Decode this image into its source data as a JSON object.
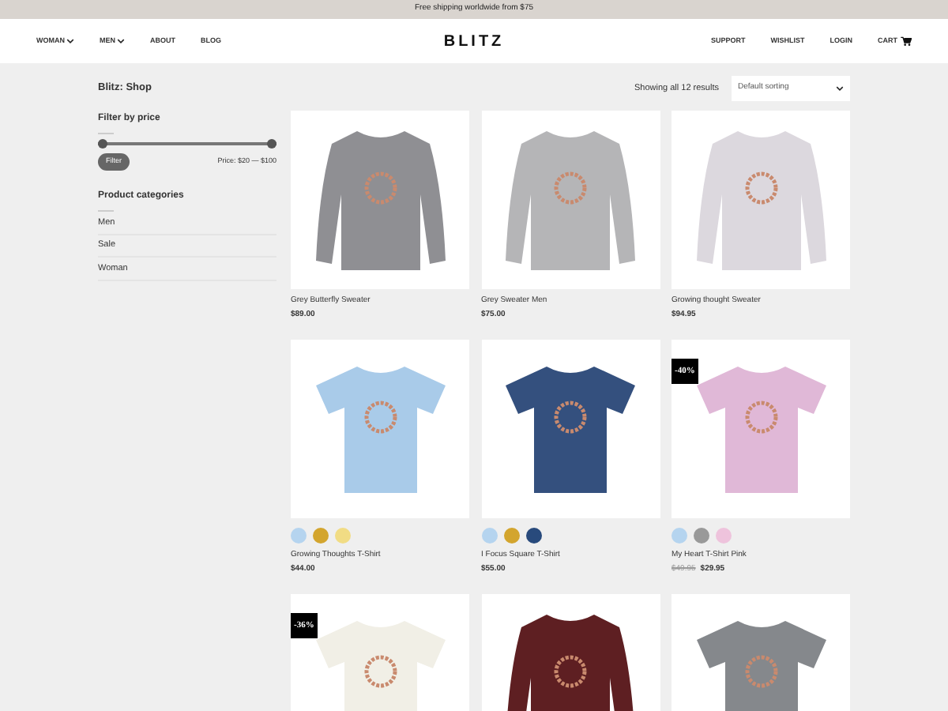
{
  "promo_bar": {
    "text": "Free shipping worldwide from $75"
  },
  "nav": {
    "left": [
      {
        "label": "WOMAN",
        "dropdown": true
      },
      {
        "label": "MEN",
        "dropdown": true
      },
      {
        "label": "ABOUT",
        "dropdown": false
      },
      {
        "label": "BLOG",
        "dropdown": false
      }
    ],
    "logo": "BLITZ",
    "right": [
      {
        "label": "SUPPORT",
        "kind": "link"
      },
      {
        "label": "WISHLIST",
        "kind": "link"
      },
      {
        "label": "LOGIN",
        "kind": "link"
      },
      {
        "label": "CART",
        "kind": "cart"
      }
    ]
  },
  "breadcrumb": "Blitz: Shop",
  "results": "Showing all 12 results",
  "sorting": {
    "value": "Default sorting"
  },
  "price_filter": {
    "title": "Filter by price",
    "level": 1,
    "button": "Filter",
    "range": "Price: $20 — $100"
  },
  "categories": {
    "title": "Product categories",
    "items": [
      "Men",
      "Sale",
      "Woman"
    ]
  },
  "products": [
    {
      "kind": "sweater",
      "color": "#8f8f93",
      "name": "Grey Butterfly Sweater",
      "price": "$89.00"
    },
    {
      "kind": "sweater",
      "color": "#b5b5b7",
      "name": "Grey Sweater Men",
      "price": "$75.00"
    },
    {
      "kind": "sweater",
      "color": "#dcd8de",
      "name": "Growing thought Sweater",
      "price": "$94.95"
    },
    {
      "kind": "tshirt",
      "color": "#a9cbe9",
      "name": "Growing Thoughts T-Shirt",
      "price": "$44.00",
      "swatches": [
        {
          "color": "#b5d4ef"
        },
        {
          "color": "#d3a52e"
        },
        {
          "color": "#f1dc84"
        }
      ]
    },
    {
      "kind": "tshirt",
      "color": "#34507e",
      "name": "I Focus Square T-Shirt",
      "price": "$55.00",
      "swatches": [
        {
          "color": "#b5d4ef"
        },
        {
          "color": "#d3a52e"
        },
        {
          "color": "#284a7c"
        }
      ]
    },
    {
      "kind": "tshirt",
      "color": "#e0b8d7",
      "name": "My Heart T-Shirt Pink",
      "old_price": "$49.95",
      "price": "$29.95",
      "badge": "-40%",
      "swatches": [
        {
          "color": "#b5d4ef"
        },
        {
          "color": "#999999"
        },
        {
          "color": "#eec3dc"
        }
      ]
    },
    {
      "kind": "tshirt",
      "color": "#f1efe6",
      "badge": "-36%"
    },
    {
      "kind": "sweater",
      "color": "#5e1f22"
    },
    {
      "kind": "tshirt",
      "color": "#85888c"
    }
  ]
}
